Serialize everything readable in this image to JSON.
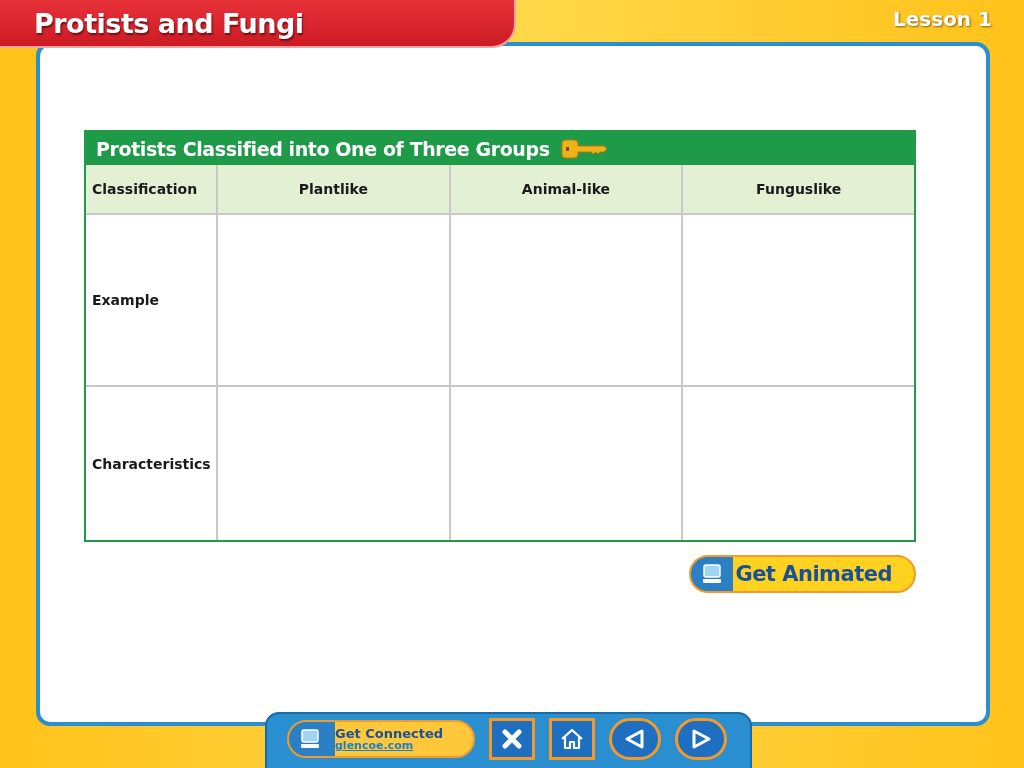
{
  "header": {
    "title": "Protists and Fungi",
    "lesson": "Lesson 1"
  },
  "table": {
    "title": "Protists Classified into One of Three Groups",
    "columns": [
      "Classification",
      "Plantlike",
      "Animal-like",
      "Funguslike"
    ],
    "rows": [
      {
        "label": "Example"
      },
      {
        "label": "Characteristics"
      }
    ]
  },
  "animate_button": {
    "label": "Get Animated"
  },
  "nav": {
    "connect_label": "Get Connected",
    "connect_link": "glencoe.com"
  }
}
